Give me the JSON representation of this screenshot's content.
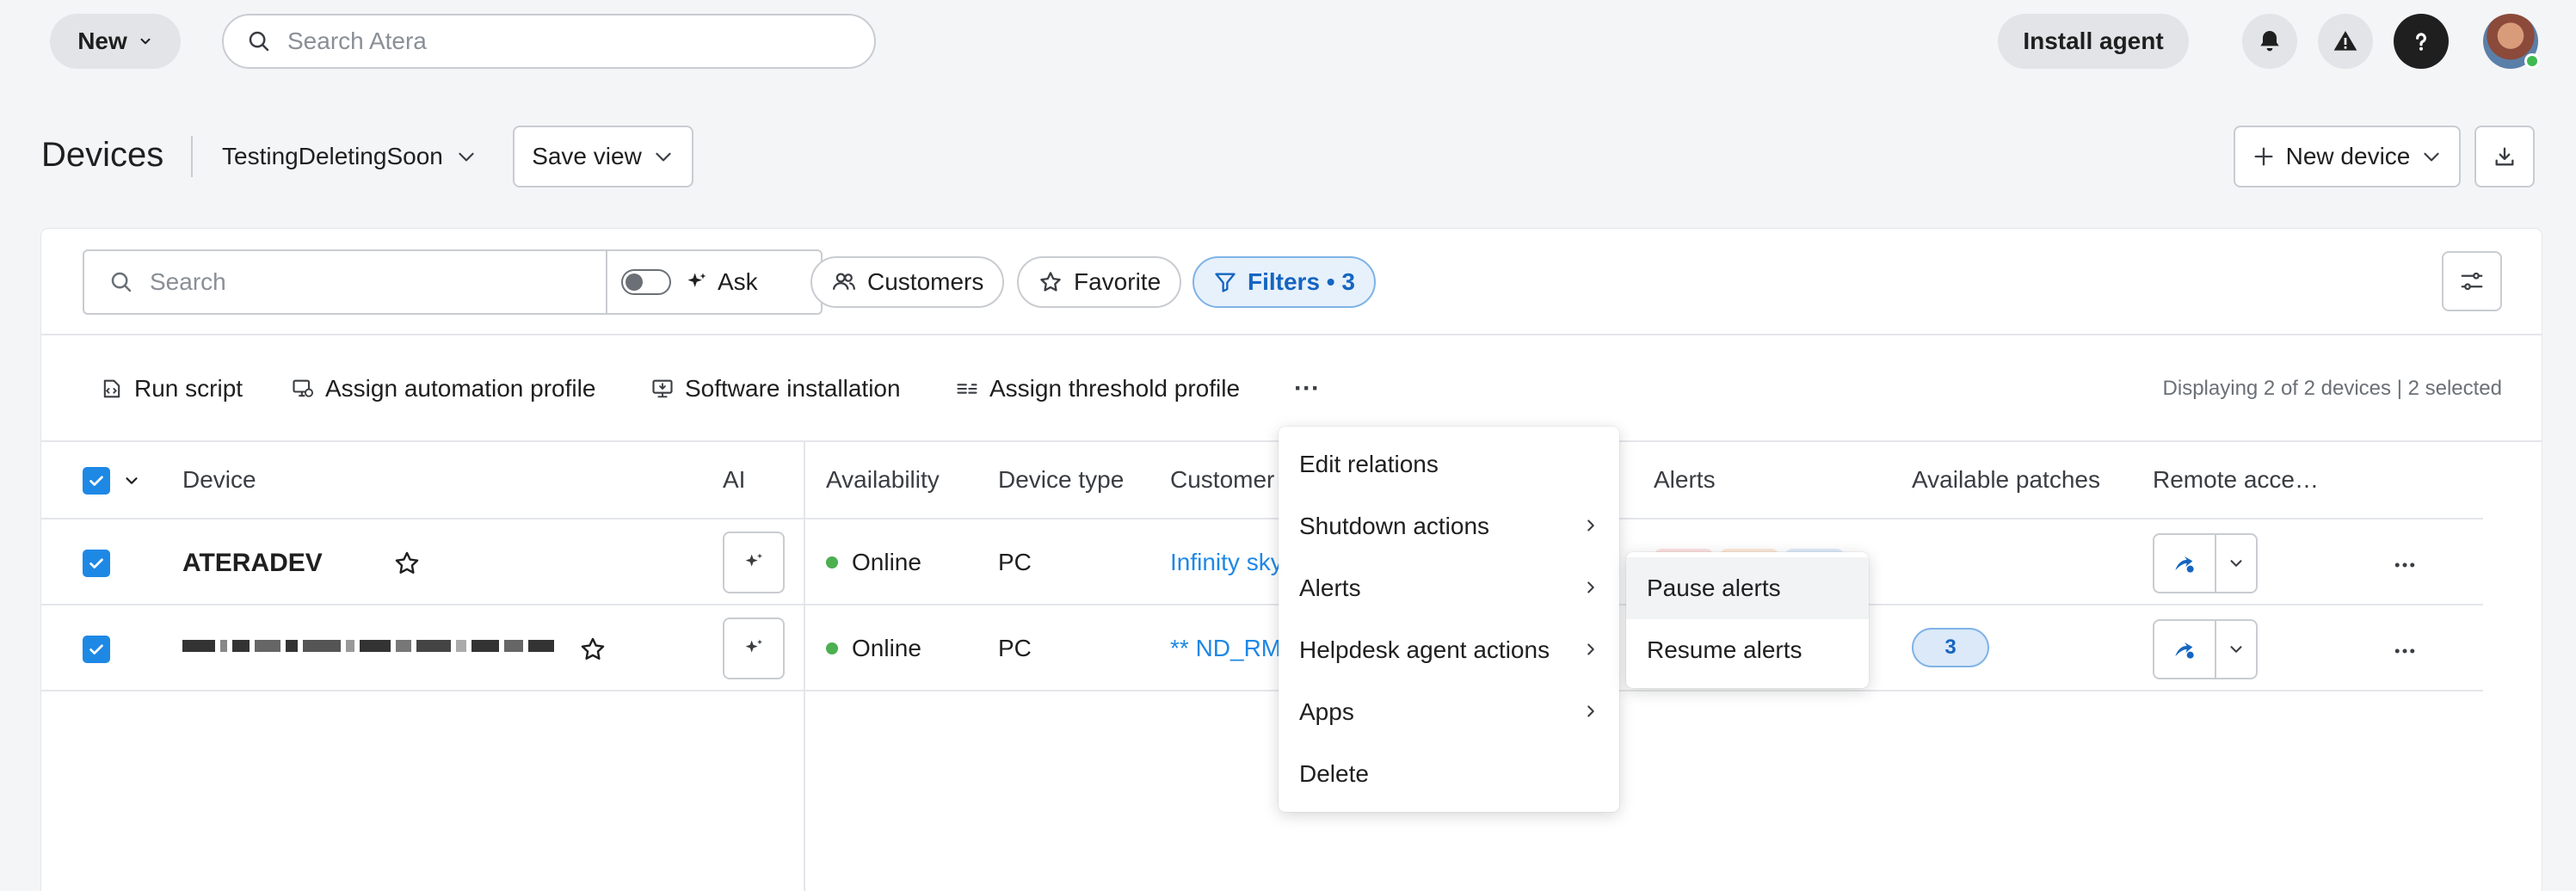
{
  "topbar": {
    "new_label": "New",
    "search_placeholder": "Search Atera",
    "install_agent_label": "Install agent"
  },
  "header": {
    "title": "Devices",
    "view_name": "TestingDeletingSoon",
    "save_view_label": "Save view",
    "new_device_label": "New device"
  },
  "filters": {
    "search_placeholder": "Search",
    "ask_label": "Ask",
    "customers_label": "Customers",
    "favorite_label": "Favorite",
    "filters_label": "Filters • 3"
  },
  "actions": {
    "run_script": "Run script",
    "assign_automation": "Assign automation profile",
    "software_installation": "Software installation",
    "assign_threshold": "Assign threshold profile",
    "more": "···",
    "display_count": "Displaying 2 of 2 devices | 2 selected"
  },
  "table": {
    "columns": {
      "device": "Device",
      "ai": "AI",
      "availability": "Availability",
      "device_type": "Device type",
      "customer": "Customer",
      "alerts": "Alerts",
      "available_patches": "Available patches",
      "remote_access": "Remote acce…"
    },
    "rows": [
      {
        "device": "ATERADEV",
        "availability": "Online",
        "device_type": "PC",
        "customer": "Infinity sky",
        "patches": ""
      },
      {
        "device": "",
        "availability": "Online",
        "device_type": "PC",
        "customer": "** ND_RM",
        "patches": "3"
      }
    ]
  },
  "more_menu": {
    "items": [
      {
        "label": "Edit relations",
        "has_submenu": false
      },
      {
        "label": "Shutdown actions",
        "has_submenu": true
      },
      {
        "label": "Alerts",
        "has_submenu": true
      },
      {
        "label": "Helpdesk agent actions",
        "has_submenu": true
      },
      {
        "label": "Apps",
        "has_submenu": true
      },
      {
        "label": "Delete",
        "has_submenu": false
      }
    ]
  },
  "alerts_submenu": {
    "items": [
      {
        "label": "Pause alerts"
      },
      {
        "label": "Resume alerts"
      }
    ]
  },
  "colors": {
    "accent": "#1e88e5",
    "online": "#4caf50",
    "filter_active_bg": "#e7f1fc"
  }
}
